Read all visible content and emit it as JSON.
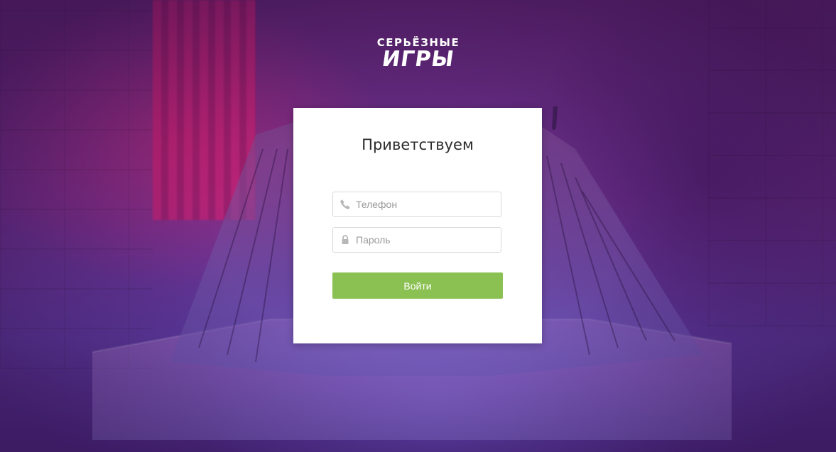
{
  "logo": {
    "line1": "СЕРЬЁЗНЫЕ",
    "line2": "ИГРЫ"
  },
  "login": {
    "title": "Приветствуем",
    "phone_placeholder": "Телефон",
    "phone_icon": "phone-icon",
    "password_placeholder": "Пароль",
    "password_icon": "lock-icon",
    "submit_label": "Войти"
  },
  "colors": {
    "button": "#8bc152",
    "overlay": "#6a2f8a",
    "card": "#ffffff"
  }
}
